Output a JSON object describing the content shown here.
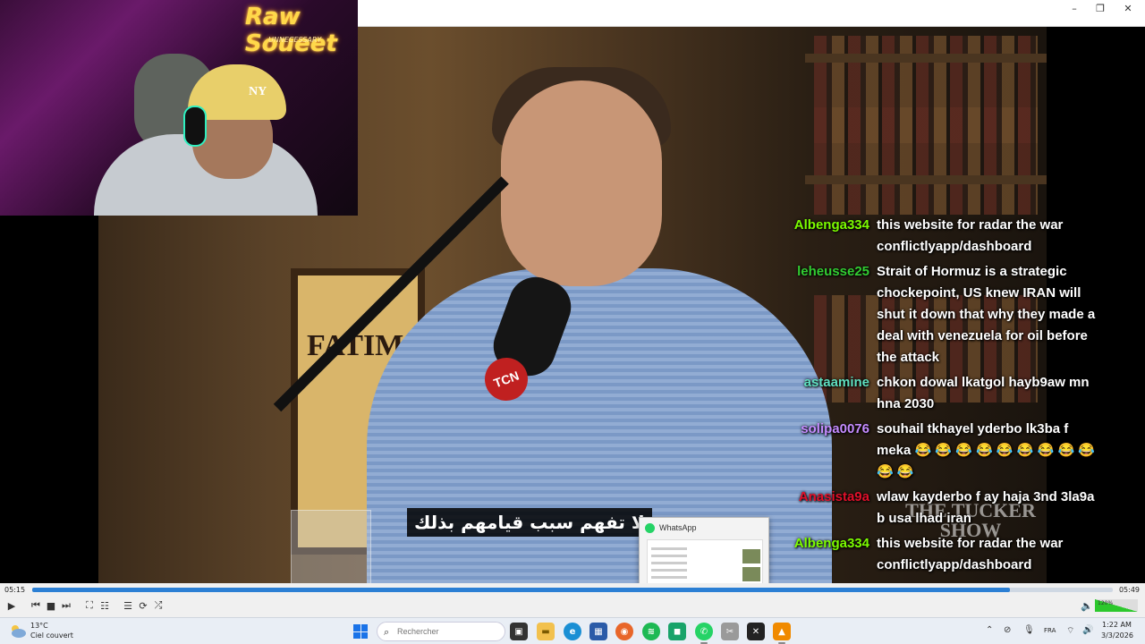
{
  "webcam": {
    "logo": "Raw Soueet",
    "logo_sub": "UNNECESSARY",
    "cap_text": "NY"
  },
  "video": {
    "poster_text": "FATIM",
    "mic_badge": "TCN",
    "show_logo": "THE TUCKER SHOW",
    "subtitle": "لا تفهم سبب قيامهم بذلك"
  },
  "chat": {
    "messages": [
      {
        "user": "Albenga334",
        "color": "#7CFC00",
        "text": "this website for radar the war conflictlyapp/dashboard"
      },
      {
        "user": "leheusse25",
        "color": "#32CD32",
        "text": "Strait of Hormuz is a strategic chockepoint, US knew IRAN will shut it down that why they made a deal with venezuela for oil before the attack"
      },
      {
        "user": "astaamine",
        "color": "#5FE0C0",
        "text": "chkon dowal lkatgol hayb9aw mn hna 2030"
      },
      {
        "user": "solipa0076",
        "color": "#C58BFF",
        "text": "souhail tkhayel yderbo lk3ba f meka 😂 😂 😂 😂 😂 😂 😂 😂 😂 😂 😂"
      },
      {
        "user": "Anasista9a",
        "color": "#E0102A",
        "text": "wlaw kayderbo f ay haja 3nd 3la9a b usa lhad iran"
      },
      {
        "user": "Albenga334",
        "color": "#7CFC00",
        "text": "this website for radar the war conflictlyapp/dashboard"
      }
    ]
  },
  "player": {
    "time_current": "05:15",
    "time_total": "05:49",
    "progress": 0.905,
    "volume_label": "120%",
    "volume": 1.0
  },
  "whatsapp_preview": {
    "title": "WhatsApp"
  },
  "taskbar": {
    "weather_temp": "13°C",
    "weather_desc": "Ciel couvert",
    "search_placeholder": "Rechercher",
    "language": "FRA",
    "time": "1:22 AM",
    "date": "3/3/2026"
  },
  "colors": {
    "seek_fill": "#2b7fd4",
    "volume_fill": "#2cc82c",
    "taskbar_bg": "#e9eef5"
  }
}
